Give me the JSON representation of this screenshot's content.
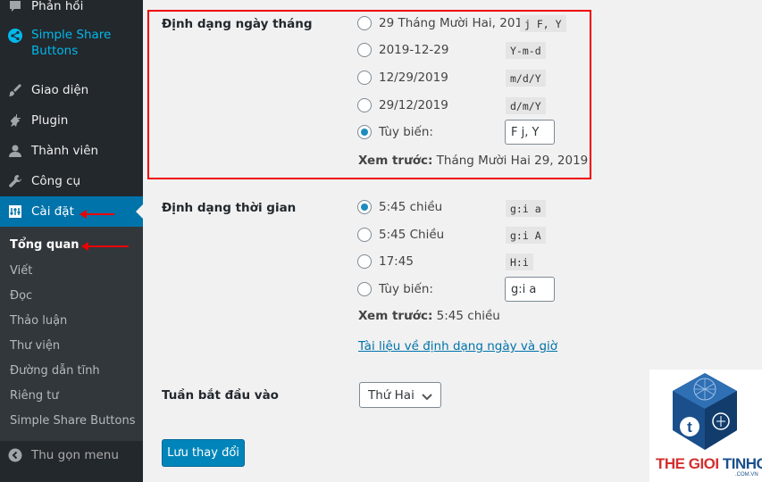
{
  "sidebar": {
    "items": [
      {
        "label": "Phản hồi",
        "icon": "comment-icon"
      },
      {
        "label": "Simple Share Buttons",
        "icon": "share-icon"
      },
      {
        "label": "Giao diện",
        "icon": "brush-icon"
      },
      {
        "label": "Plugin",
        "icon": "plugin-icon"
      },
      {
        "label": "Thành viên",
        "icon": "user-icon"
      },
      {
        "label": "Công cụ",
        "icon": "wrench-icon"
      },
      {
        "label": "Cài đặt",
        "icon": "settings-icon"
      }
    ],
    "submenu": [
      "Tổng quan",
      "Viết",
      "Đọc",
      "Thảo luận",
      "Thư viện",
      "Đường dẫn tĩnh",
      "Riêng tư",
      "Simple Share Buttons"
    ],
    "collapse_label": "Thu gọn menu"
  },
  "date_format": {
    "label": "Định dạng ngày tháng",
    "options": [
      {
        "label": "29 Tháng Mười Hai, 2019",
        "code": "j F, Y"
      },
      {
        "label": "2019-12-29",
        "code": "Y-m-d"
      },
      {
        "label": "12/29/2019",
        "code": "m/d/Y"
      },
      {
        "label": "29/12/2019",
        "code": "d/m/Y"
      },
      {
        "label": "Tùy biến:",
        "code": ""
      }
    ],
    "custom_value": "F j, Y",
    "selected": 4,
    "preview_label": "Xem trước:",
    "preview_value": " Tháng Mười Hai 29, 2019"
  },
  "time_format": {
    "label": "Định dạng thời gian",
    "options": [
      {
        "label": "5:45 chiều",
        "code": "g:i a"
      },
      {
        "label": "5:45 Chiều",
        "code": "g:i A"
      },
      {
        "label": "17:45",
        "code": "H:i"
      },
      {
        "label": "Tùy biến:",
        "code": ""
      }
    ],
    "custom_value": "g:i a",
    "selected": 0,
    "preview_label": "Xem trước:",
    "preview_value": " 5:45 chiều",
    "doc_link": "Tài liệu về định dạng ngày và giờ",
    "doc_link_suffix": "."
  },
  "week_start": {
    "label": "Tuần bắt đầu vào",
    "selected": "Thứ Hai"
  },
  "save_label": "Lưu thay đổi",
  "logo": {
    "text_a": "THE GIOI ",
    "text_b": "TINHOC",
    "sub": ".COM.VN",
    "colors": {
      "red": "#d32f2f",
      "blue": "#1a4f8b"
    }
  },
  "colors": {
    "accent": "#0073aa",
    "sidebar": "#23282d",
    "highlight": "#ee0000"
  }
}
